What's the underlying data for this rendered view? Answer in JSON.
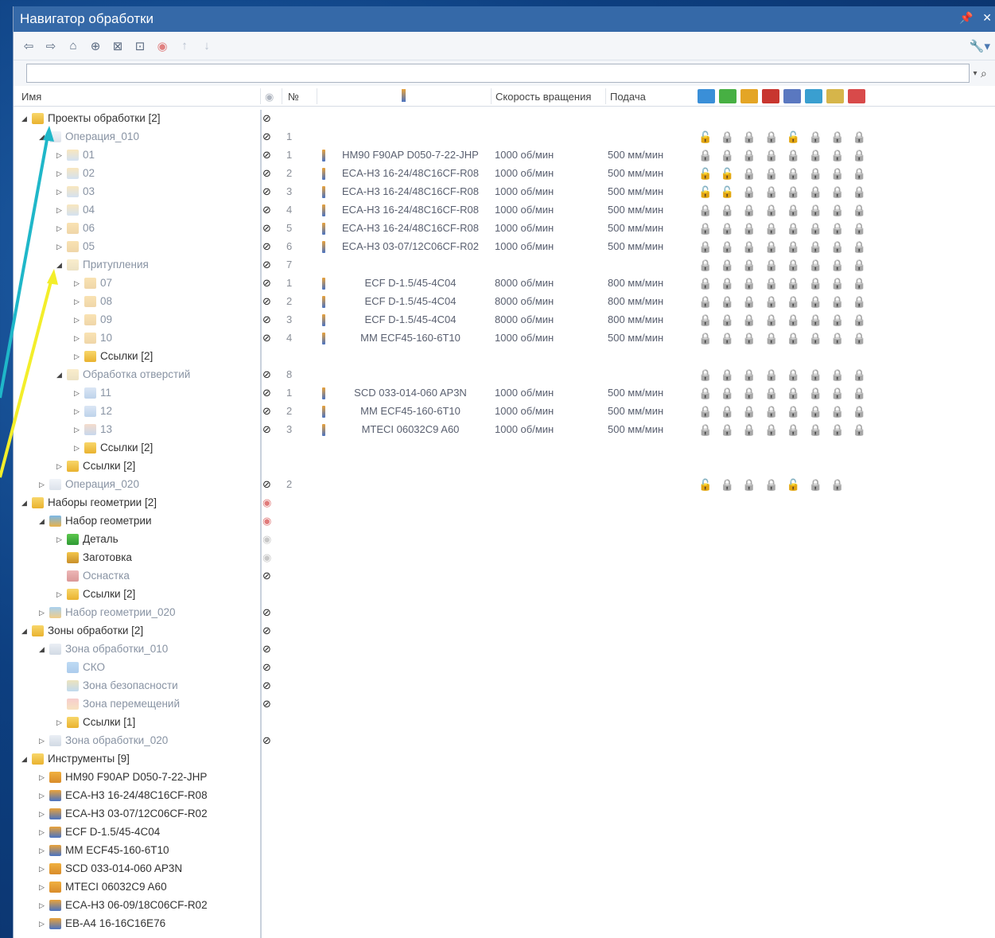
{
  "window": {
    "title": "Навигатор обработки",
    "controls": [
      "📌",
      "✕"
    ]
  },
  "toolbar": {
    "buttons": [
      {
        "name": "back-icon",
        "glyph": "⇦"
      },
      {
        "name": "forward-icon",
        "glyph": "⇨"
      },
      {
        "name": "home-icon",
        "glyph": "⌂"
      },
      {
        "name": "target-icon",
        "glyph": "⊕"
      },
      {
        "name": "collapse-icon",
        "glyph": "⊠"
      },
      {
        "name": "expand-icon",
        "glyph": "⊡"
      },
      {
        "name": "eye-icon",
        "glyph": "◉"
      },
      {
        "name": "up-arrow-icon",
        "glyph": "↑"
      },
      {
        "name": "down-arrow-icon",
        "glyph": "↓"
      }
    ],
    "settings_glyph": "🔧▾"
  },
  "search": {
    "value": "",
    "placeholder": "",
    "drop_glyph": "▾",
    "icon_glyph": "⌕"
  },
  "columns": {
    "name": "Имя",
    "eye_glyph": "◉",
    "number": "№",
    "speed": "Скорость вращения",
    "feed": "Подача",
    "icon_colors": [
      "#3a8fd8",
      "#47b043",
      "#e4a525",
      "#c8362f",
      "#5a78c0",
      "#3a9fd0",
      "#d6b54a",
      "#d84a4a"
    ]
  },
  "colors": {
    "title_bar": "#3569a8",
    "folder": "#f2c443",
    "eye": "#222222",
    "lock_on": "#4a6fb5",
    "arrow_cyan": "#1fb7c9",
    "arrow_yellow": "#f3ee2a"
  },
  "rows": [
    {
      "level": 0,
      "tw": "◢",
      "icon": "folder",
      "label": "Проекты обработки [2]",
      "dim": false,
      "eye": "on",
      "num": "",
      "tool": "",
      "speed": "",
      "feed": "",
      "locks": ""
    },
    {
      "level": 1,
      "tw": "◢",
      "icon": "op",
      "label": "Операция_010",
      "dim": true,
      "eye": "on",
      "num": "1",
      "tool": "",
      "speed": "",
      "feed": "",
      "locks": "10001000"
    },
    {
      "level": 2,
      "tw": "▷",
      "icon": "step",
      "label": "01",
      "dim": true,
      "eye": "on",
      "num": "1",
      "tool": "HM90 F90AP D050-7-22-JHP",
      "speed": "1000 об/мин",
      "feed": "500 мм/мин",
      "locks": "00000000"
    },
    {
      "level": 2,
      "tw": "▷",
      "icon": "step",
      "label": "02",
      "dim": true,
      "eye": "on",
      "num": "2",
      "tool": "ECA-H3 16-24/48C16CF-R08",
      "speed": "1000 об/мин",
      "feed": "500 мм/мин",
      "locks": "11000000"
    },
    {
      "level": 2,
      "tw": "▷",
      "icon": "step",
      "label": "03",
      "dim": true,
      "eye": "on",
      "num": "3",
      "tool": "ECA-H3 16-24/48C16CF-R08",
      "speed": "1000 об/мин",
      "feed": "500 мм/мин",
      "locks": "11000000"
    },
    {
      "level": 2,
      "tw": "▷",
      "icon": "step",
      "label": "04",
      "dim": true,
      "eye": "on",
      "num": "4",
      "tool": "ECA-H3 16-24/48C16CF-R08",
      "speed": "1000 об/мин",
      "feed": "500 мм/мин",
      "locks": "00000000"
    },
    {
      "level": 2,
      "tw": "▷",
      "icon": "step2",
      "label": "06",
      "dim": true,
      "eye": "on",
      "num": "5",
      "tool": "ECA-H3 16-24/48C16CF-R08",
      "speed": "1000 об/мин",
      "feed": "500 мм/мин",
      "locks": "00000000"
    },
    {
      "level": 2,
      "tw": "▷",
      "icon": "step2",
      "label": "05",
      "dim": true,
      "eye": "on",
      "num": "6",
      "tool": "ECA-H3 03-07/12C06CF-R02",
      "speed": "1000 об/мин",
      "feed": "500 мм/мин",
      "locks": "00000000"
    },
    {
      "level": 2,
      "tw": "◢",
      "icon": "group",
      "label": "Притупления",
      "dim": true,
      "eye": "on",
      "num": "7",
      "tool": "",
      "speed": "",
      "feed": "",
      "locks": "00000000"
    },
    {
      "level": 3,
      "tw": "▷",
      "icon": "step2",
      "label": "07",
      "dim": true,
      "eye": "on",
      "num": "1",
      "tool": "ECF D-1.5/45-4C04",
      "speed": "8000 об/мин",
      "feed": "800 мм/мин",
      "locks": "00000000"
    },
    {
      "level": 3,
      "tw": "▷",
      "icon": "step2",
      "label": "08",
      "dim": true,
      "eye": "on",
      "num": "2",
      "tool": "ECF D-1.5/45-4C04",
      "speed": "8000 об/мин",
      "feed": "800 мм/мин",
      "locks": "00000000"
    },
    {
      "level": 3,
      "tw": "▷",
      "icon": "step2",
      "label": "09",
      "dim": true,
      "eye": "on",
      "num": "3",
      "tool": "ECF D-1.5/45-4C04",
      "speed": "8000 об/мин",
      "feed": "800 мм/мин",
      "locks": "00000000"
    },
    {
      "level": 3,
      "tw": "▷",
      "icon": "step2",
      "label": "10",
      "dim": true,
      "eye": "on",
      "num": "4",
      "tool": "MM ECF45-160-6T10",
      "speed": "1000 об/мин",
      "feed": "500 мм/мин",
      "locks": "00000000"
    },
    {
      "level": 3,
      "tw": "▷",
      "icon": "folder",
      "label": "Ссылки [2]",
      "dim": false,
      "eye": "",
      "num": "",
      "tool": "",
      "speed": "",
      "feed": "",
      "locks": ""
    },
    {
      "level": 2,
      "tw": "◢",
      "icon": "group",
      "label": "Обработка отверстий",
      "dim": true,
      "eye": "on",
      "num": "8",
      "tool": "",
      "speed": "",
      "feed": "",
      "locks": "00000000"
    },
    {
      "level": 3,
      "tw": "▷",
      "icon": "drill",
      "label": "11",
      "dim": true,
      "eye": "on",
      "num": "1",
      "tool": "SCD 033-014-060 AP3N",
      "speed": "1000 об/мин",
      "feed": "500 мм/мин",
      "locks": "00000000"
    },
    {
      "level": 3,
      "tw": "▷",
      "icon": "drill",
      "label": "12",
      "dim": true,
      "eye": "on",
      "num": "2",
      "tool": "MM ECF45-160-6T10",
      "speed": "1000 об/мин",
      "feed": "500 мм/мин",
      "locks": "00000000"
    },
    {
      "level": 3,
      "tw": "▷",
      "icon": "drill2",
      "label": "13",
      "dim": true,
      "eye": "on",
      "num": "3",
      "tool": "MTECI 06032C9 A60",
      "speed": "1000 об/мин",
      "feed": "500 мм/мин",
      "locks": "00000000"
    },
    {
      "level": 3,
      "tw": "▷",
      "icon": "folder",
      "label": "Ссылки [2]",
      "dim": false,
      "eye": "",
      "num": "",
      "tool": "",
      "speed": "",
      "feed": "",
      "locks": ""
    },
    {
      "level": 2,
      "tw": "▷",
      "icon": "folder",
      "label": "Ссылки [2]",
      "dim": false,
      "eye": "",
      "num": "",
      "tool": "",
      "speed": "",
      "feed": "",
      "locks": ""
    },
    {
      "level": 1,
      "tw": "▷",
      "icon": "op",
      "label": "Операция_020",
      "dim": true,
      "eye": "on",
      "num": "2",
      "tool": "",
      "speed": "",
      "feed": "",
      "locks": "1000100"
    },
    {
      "level": 0,
      "tw": "◢",
      "icon": "folder",
      "label": "Наборы геометрии [2]",
      "dim": false,
      "eye": "red",
      "num": "",
      "tool": "",
      "speed": "",
      "feed": "",
      "locks": ""
    },
    {
      "level": 1,
      "tw": "◢",
      "icon": "geom",
      "label": "Набор геометрии",
      "dim": false,
      "eye": "red",
      "num": "",
      "tool": "",
      "speed": "",
      "feed": "",
      "locks": ""
    },
    {
      "level": 2,
      "tw": "▷",
      "icon": "part",
      "label": "Деталь",
      "dim": false,
      "eye": "grey",
      "num": "",
      "tool": "",
      "speed": "",
      "feed": "",
      "locks": ""
    },
    {
      "level": 2,
      "tw": "",
      "icon": "stock",
      "label": "Заготовка",
      "dim": false,
      "eye": "grey",
      "num": "",
      "tool": "",
      "speed": "",
      "feed": "",
      "locks": ""
    },
    {
      "level": 2,
      "tw": "",
      "icon": "fixture",
      "label": "Оснастка",
      "dim": true,
      "eye": "on",
      "num": "",
      "tool": "",
      "speed": "",
      "feed": "",
      "locks": ""
    },
    {
      "level": 2,
      "tw": "▷",
      "icon": "folder",
      "label": "Ссылки [2]",
      "dim": false,
      "eye": "",
      "num": "",
      "tool": "",
      "speed": "",
      "feed": "",
      "locks": ""
    },
    {
      "level": 1,
      "tw": "▷",
      "icon": "geom",
      "label": "Набор геометрии_020",
      "dim": true,
      "eye": "on",
      "num": "",
      "tool": "",
      "speed": "",
      "feed": "",
      "locks": ""
    },
    {
      "level": 0,
      "tw": "◢",
      "icon": "folder",
      "label": "Зоны обработки [2]",
      "dim": false,
      "eye": "on",
      "num": "",
      "tool": "",
      "speed": "",
      "feed": "",
      "locks": ""
    },
    {
      "level": 1,
      "tw": "◢",
      "icon": "zone",
      "label": "Зона обработки_010",
      "dim": true,
      "eye": "on",
      "num": "",
      "tool": "",
      "speed": "",
      "feed": "",
      "locks": ""
    },
    {
      "level": 2,
      "tw": "",
      "icon": "csys",
      "label": "СКО",
      "dim": true,
      "eye": "on",
      "num": "",
      "tool": "",
      "speed": "",
      "feed": "",
      "locks": ""
    },
    {
      "level": 2,
      "tw": "",
      "icon": "safe",
      "label": "Зона безопасности",
      "dim": true,
      "eye": "on",
      "num": "",
      "tool": "",
      "speed": "",
      "feed": "",
      "locks": ""
    },
    {
      "level": 2,
      "tw": "",
      "icon": "move",
      "label": "Зона перемещений",
      "dim": true,
      "eye": "on",
      "num": "",
      "tool": "",
      "speed": "",
      "feed": "",
      "locks": ""
    },
    {
      "level": 2,
      "tw": "▷",
      "icon": "folder",
      "label": "Ссылки [1]",
      "dim": false,
      "eye": "",
      "num": "",
      "tool": "",
      "speed": "",
      "feed": "",
      "locks": ""
    },
    {
      "level": 1,
      "tw": "▷",
      "icon": "zone",
      "label": "Зона обработки_020",
      "dim": true,
      "eye": "on",
      "num": "",
      "tool": "",
      "speed": "",
      "feed": "",
      "locks": ""
    },
    {
      "level": 0,
      "tw": "◢",
      "icon": "folder",
      "label": "Инструменты [9]",
      "dim": false,
      "eye": "",
      "num": "",
      "tool": "",
      "speed": "",
      "feed": "",
      "locks": ""
    },
    {
      "level": 1,
      "tw": "▷",
      "icon": "tool-o",
      "label": "HM90 F90AP D050-7-22-JHP",
      "dim": false,
      "eye": "",
      "num": "",
      "tool": "",
      "speed": "",
      "feed": "",
      "locks": ""
    },
    {
      "level": 1,
      "tw": "▷",
      "icon": "tool",
      "label": "ECA-H3 16-24/48C16CF-R08",
      "dim": false,
      "eye": "",
      "num": "",
      "tool": "",
      "speed": "",
      "feed": "",
      "locks": ""
    },
    {
      "level": 1,
      "tw": "▷",
      "icon": "tool",
      "label": "ECA-H3 03-07/12C06CF-R02",
      "dim": false,
      "eye": "",
      "num": "",
      "tool": "",
      "speed": "",
      "feed": "",
      "locks": ""
    },
    {
      "level": 1,
      "tw": "▷",
      "icon": "tool",
      "label": "ECF D-1.5/45-4C04",
      "dim": false,
      "eye": "",
      "num": "",
      "tool": "",
      "speed": "",
      "feed": "",
      "locks": ""
    },
    {
      "level": 1,
      "tw": "▷",
      "icon": "tool",
      "label": "MM ECF45-160-6T10",
      "dim": false,
      "eye": "",
      "num": "",
      "tool": "",
      "speed": "",
      "feed": "",
      "locks": ""
    },
    {
      "level": 1,
      "tw": "▷",
      "icon": "tool-o",
      "label": "SCD 033-014-060 AP3N",
      "dim": false,
      "eye": "",
      "num": "",
      "tool": "",
      "speed": "",
      "feed": "",
      "locks": ""
    },
    {
      "level": 1,
      "tw": "▷",
      "icon": "tool-o",
      "label": "MTECI 06032C9 A60",
      "dim": false,
      "eye": "",
      "num": "",
      "tool": "",
      "speed": "",
      "feed": "",
      "locks": ""
    },
    {
      "level": 1,
      "tw": "▷",
      "icon": "tool",
      "label": "ECA-H3 06-09/18C06CF-R02",
      "dim": false,
      "eye": "",
      "num": "",
      "tool": "",
      "speed": "",
      "feed": "",
      "locks": ""
    },
    {
      "level": 1,
      "tw": "▷",
      "icon": "tool",
      "label": "EB-A4 16-16C16E76",
      "dim": false,
      "eye": "",
      "num": "",
      "tool": "",
      "speed": "",
      "feed": "",
      "locks": ""
    }
  ]
}
